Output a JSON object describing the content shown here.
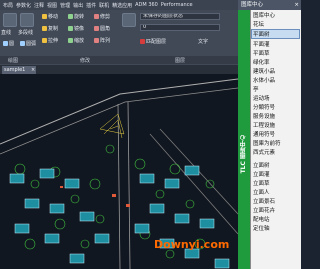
{
  "menubar": {
    "items": [
      "布局",
      "参数化",
      "注释",
      "视图",
      "管理",
      "输出",
      "插件",
      "联机",
      "精选应用",
      "ADM 360",
      "Performance"
    ]
  },
  "ribbon": {
    "left_tools": [
      "直线",
      "多段线",
      "圆",
      "圆弧"
    ],
    "modify_tools": [
      "移动",
      "旋转",
      "修剪",
      "复制",
      "镜像",
      "圆角",
      "拉伸",
      "缩放",
      "阵列"
    ],
    "layer_combo": "未保存的图层状态",
    "layer_current": "0",
    "annotation_label": "文字",
    "match_layer": "匹配图层",
    "bylayer": "ByLayer",
    "panel_titles": [
      "绘图",
      "修改",
      "图层"
    ]
  },
  "tabs": {
    "doc": "sample1",
    "close_glyph": "×"
  },
  "palette": {
    "title": "图库中心",
    "close_glyph": "×",
    "strip_text": "TLC 图库中心",
    "items": [
      "图库中心",
      "花坛",
      "平面树",
      "平面灌",
      "平面草",
      "绿化率",
      "建筑小品",
      "水体小品",
      "亭",
      "运动场",
      "分類符号",
      "服务设施",
      "工程设施",
      "通用符号",
      "图庫为前符",
      "西式元素",
      "立面树",
      "立面灌",
      "立面草",
      "立面人",
      "立面景石",
      "立面花卉",
      "配电站",
      "定位轴"
    ],
    "selected_index": 2
  },
  "watermark": "Downyi.com",
  "colors": {
    "palette_strip": "#1f9a3c",
    "selection": "#c7dcf1",
    "watermark": "#ff6a00"
  }
}
